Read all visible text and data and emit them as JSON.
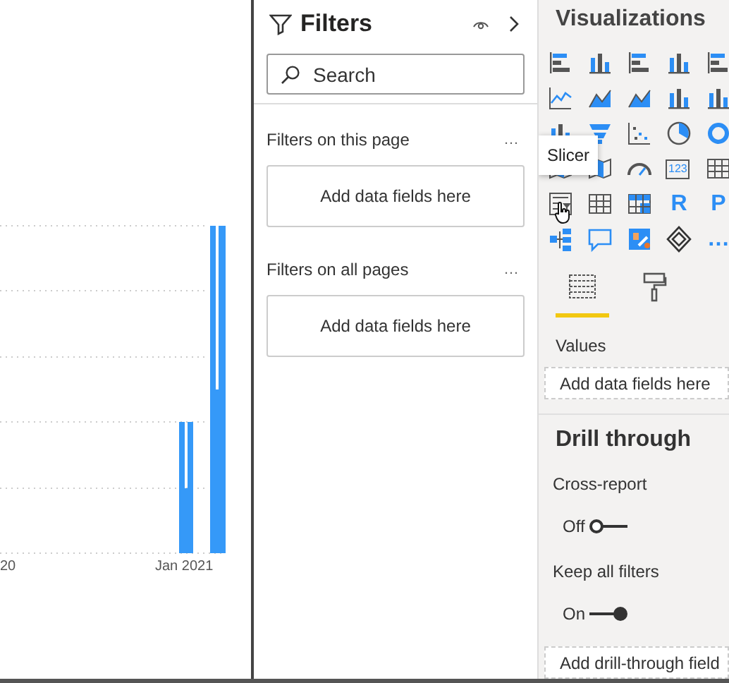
{
  "report_canvas": {
    "axis_labels": [
      "20",
      "Jan 2021"
    ]
  },
  "filters_pane": {
    "title": "Filters",
    "search": {
      "placeholder": "Search"
    },
    "sections": [
      {
        "title": "Filters on this page",
        "more": "…",
        "drop_zone": "Add data fields here"
      },
      {
        "title": "Filters on all pages",
        "more": "…",
        "drop_zone": "Add data fields here"
      }
    ]
  },
  "visualizations_pane": {
    "title": "Visualizations",
    "visuals": [
      {
        "kind": "bars"
      },
      {
        "kind": "columns"
      },
      {
        "kind": "bars"
      },
      {
        "kind": "columns"
      },
      {
        "kind": "bars"
      },
      {
        "kind": "line"
      },
      {
        "kind": "area"
      },
      {
        "kind": "area"
      },
      {
        "kind": "columns"
      },
      {
        "kind": "columns"
      },
      {
        "kind": "columns"
      },
      {
        "kind": "funnel"
      },
      {
        "kind": "scatter"
      },
      {
        "kind": "pie"
      },
      {
        "kind": "donut"
      },
      {
        "kind": "map"
      },
      {
        "kind": "map"
      },
      {
        "kind": "gauge"
      },
      {
        "kind": "card",
        "label": "123"
      },
      {
        "kind": "table"
      },
      {
        "kind": "slicer"
      },
      {
        "kind": "table"
      },
      {
        "kind": "matrix"
      },
      {
        "kind": "letter",
        "label": "R"
      },
      {
        "kind": "letter",
        "label": "P"
      },
      {
        "kind": "tree"
      },
      {
        "kind": "comment"
      },
      {
        "kind": "app"
      },
      {
        "kind": "diamond"
      },
      {
        "kind": "letter",
        "label": "…"
      }
    ],
    "tooltip": "Slicer",
    "tabs": [
      {
        "kind": "fields",
        "selected": true
      },
      {
        "kind": "format",
        "selected": false
      }
    ],
    "values": {
      "label": "Values",
      "drop_zone": "Add data fields here"
    },
    "drill_through": {
      "title": "Drill through",
      "toggles": [
        {
          "label": "Cross-report",
          "state": "Off",
          "on": false
        },
        {
          "label": "Keep all filters",
          "state": "On",
          "on": true
        }
      ],
      "drop_zone": "Add drill-through field"
    }
  }
}
